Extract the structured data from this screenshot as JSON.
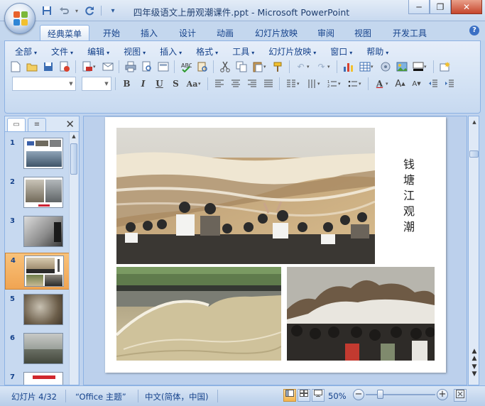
{
  "window": {
    "title": "四年级语文上册观潮课件.ppt - Microsoft PowerPoint",
    "minimize": "─",
    "restore": "❐",
    "close": "✕"
  },
  "qat": {
    "save": "💾",
    "undo": "↶",
    "redo": "↻",
    "more": "▾"
  },
  "tabs": [
    {
      "label": "经典菜单"
    },
    {
      "label": "开始"
    },
    {
      "label": "插入"
    },
    {
      "label": "设计"
    },
    {
      "label": "动画"
    },
    {
      "label": "幻灯片放映"
    },
    {
      "label": "审阅"
    },
    {
      "label": "视图"
    },
    {
      "label": "开发工具"
    }
  ],
  "help": "?",
  "menus": [
    {
      "label": "全部"
    },
    {
      "label": "文件"
    },
    {
      "label": "编辑"
    },
    {
      "label": "视图"
    },
    {
      "label": "插入"
    },
    {
      "label": "格式"
    },
    {
      "label": "工具"
    },
    {
      "label": "幻灯片放映"
    },
    {
      "label": "窗口"
    },
    {
      "label": "帮助"
    }
  ],
  "format": {
    "bold": "B",
    "italic": "I",
    "underline": "U",
    "shadow": "S",
    "case": "Aa",
    "fontcolor": "A"
  },
  "pane": {
    "slides_tab_icon": "▭",
    "outline_tab_icon": "≡",
    "close": "✕",
    "thumbnails": [
      {
        "num": "1"
      },
      {
        "num": "2"
      },
      {
        "num": "3"
      },
      {
        "num": "4"
      },
      {
        "num": "5"
      },
      {
        "num": "6"
      },
      {
        "num": "7"
      }
    ]
  },
  "slide": {
    "title_chars": [
      "钱",
      "塘",
      "江",
      "观",
      "潮"
    ]
  },
  "status": {
    "slide_info": "幻灯片 4/32",
    "theme": "“Office 主题”",
    "language": "中文(简体，中国)",
    "zoom": "50%",
    "zoom_out": "−",
    "zoom_in": "+"
  },
  "colors": {
    "ribbon_bg": "#d3e2f4",
    "accent": "#15428b",
    "selected_thumb": "#f0a452",
    "close_btn": "#c6452c"
  }
}
